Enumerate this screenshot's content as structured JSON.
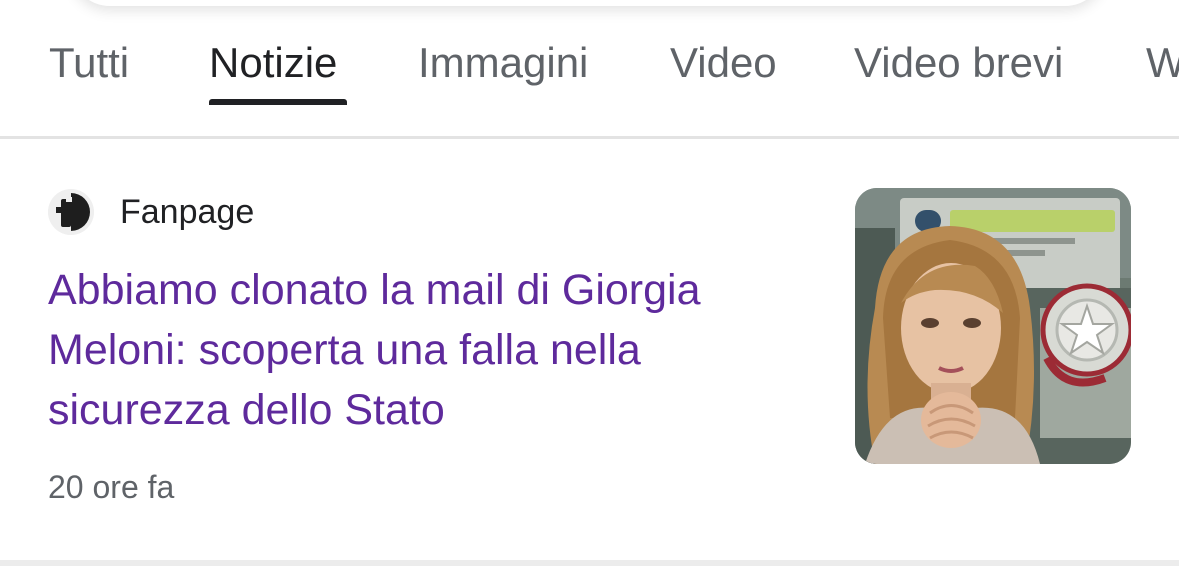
{
  "tabs": [
    {
      "label": "Tutti",
      "active": false
    },
    {
      "label": "Notizie",
      "active": true
    },
    {
      "label": "Immagini",
      "active": false
    },
    {
      "label": "Video",
      "active": false
    },
    {
      "label": "Video brevi",
      "active": false
    },
    {
      "label": "W",
      "active": false
    }
  ],
  "article": {
    "source": "Fanpage",
    "source_icon": "fanpage-logo-icon",
    "headline": "Abbiamo clonato la mail di Giorgia Meloni: scoperta una falla nella sicurezza dello Stato",
    "time": "20 ore fa",
    "thumbnail": "news-thumbnail-image"
  },
  "colors": {
    "headline": "#5e2a9c",
    "tab_active": "#202124",
    "tab_inactive": "#5f6368",
    "divider": "#e3e3e3"
  }
}
